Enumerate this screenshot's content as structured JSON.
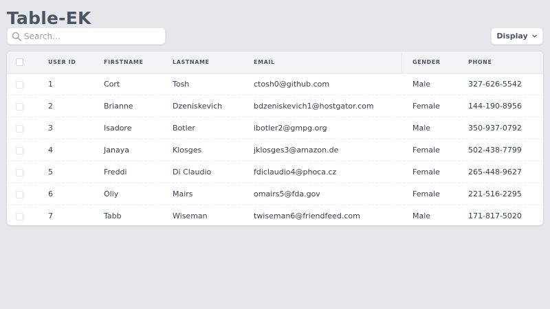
{
  "page": {
    "title": "Table-EK"
  },
  "search": {
    "placeholder": "Search...",
    "icon": "search-icon"
  },
  "display_button": {
    "label": "Display",
    "icon": "chevron-down-icon"
  },
  "table": {
    "columns": {
      "user_id": "USER ID",
      "firstname": "FIRSTNAME",
      "lastname": "LASTNAME",
      "email": "EMAIL",
      "gender": "GENDER",
      "phone": "PHONE"
    },
    "rows": [
      {
        "id": "1",
        "first": "Cort",
        "last": "Tosh",
        "email": "ctosh0@github.com",
        "gender": "Male",
        "phone": "327-626-5542"
      },
      {
        "id": "2",
        "first": "Brianne",
        "last": "Dzeniskevich",
        "email": "bdzeniskevich1@hostgator.com",
        "gender": "Female",
        "phone": "144-190-8956"
      },
      {
        "id": "3",
        "first": "Isadore",
        "last": "Botler",
        "email": "ibotler2@gmpg.org",
        "gender": "Male",
        "phone": "350-937-0792"
      },
      {
        "id": "4",
        "first": "Janaya",
        "last": "Klosges",
        "email": "jklosges3@amazon.de",
        "gender": "Female",
        "phone": "502-438-7799"
      },
      {
        "id": "5",
        "first": "Freddi",
        "last": "Di Claudio",
        "email": "fdiclaudio4@phoca.cz",
        "gender": "Female",
        "phone": "265-448-9627"
      },
      {
        "id": "6",
        "first": "Oliy",
        "last": "Mairs",
        "email": "omairs5@fda.gov",
        "gender": "Female",
        "phone": "221-516-2295"
      },
      {
        "id": "7",
        "first": "Tabb",
        "last": "Wiseman",
        "email": "twiseman6@friendfeed.com",
        "gender": "Male",
        "phone": "171-817-5020"
      }
    ]
  },
  "colors": {
    "background": "#e5e7eb",
    "header_bg": "#f3f4f6",
    "title": "#4b5563",
    "text": "#374151"
  }
}
